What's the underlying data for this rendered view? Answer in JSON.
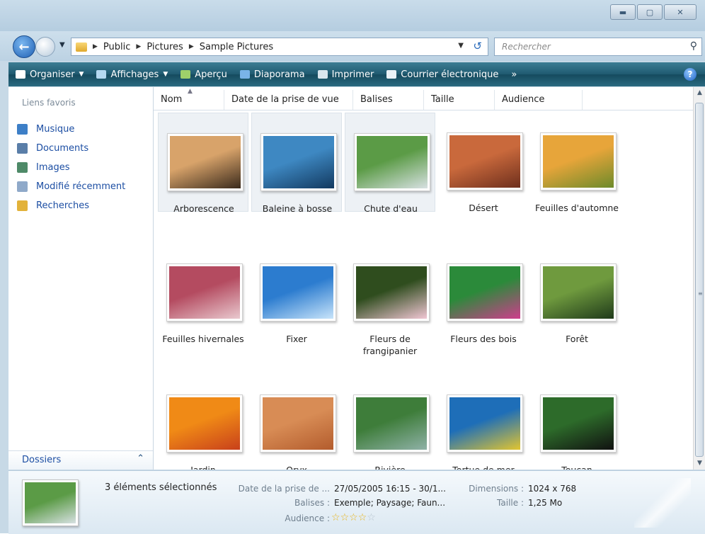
{
  "window": {
    "buttons": {
      "minimize": "▬",
      "maximize": "▢",
      "close": "✕"
    }
  },
  "address": {
    "crumbs": [
      "Public",
      "Pictures",
      "Sample Pictures"
    ],
    "search_placeholder": "Rechercher"
  },
  "toolbar": {
    "items": [
      {
        "label": "Organiser",
        "icon": "organize-icon",
        "dropdown": true,
        "color": "#ffffff"
      },
      {
        "label": "Affichages",
        "icon": "views-icon",
        "dropdown": true,
        "color": "#b4d8f0"
      },
      {
        "label": "Aperçu",
        "icon": "preview-icon",
        "dropdown": false,
        "color": "#9fd06a"
      },
      {
        "label": "Diaporama",
        "icon": "slideshow-icon",
        "dropdown": false,
        "color": "#7ab4e8"
      },
      {
        "label": "Imprimer",
        "icon": "print-icon",
        "dropdown": false,
        "color": "#d9e6ee"
      },
      {
        "label": "Courrier électronique",
        "icon": "email-icon",
        "dropdown": false,
        "color": "#e9f1f6"
      }
    ],
    "more": "»"
  },
  "sidebar": {
    "title": "Liens favoris",
    "items": [
      {
        "label": "Musique",
        "icon": "music-icon",
        "color": "#3d7fc7"
      },
      {
        "label": "Documents",
        "icon": "documents-icon",
        "color": "#5a7ea8"
      },
      {
        "label": "Images",
        "icon": "images-icon",
        "color": "#4e8a68"
      },
      {
        "label": "Modifié récemment",
        "icon": "recent-icon",
        "color": "#8fa9c9"
      },
      {
        "label": "Recherches",
        "icon": "searches-icon",
        "color": "#e2b23a"
      }
    ],
    "folders_label": "Dossiers"
  },
  "columns": [
    "Nom",
    "Date de la prise de vue",
    "Balises",
    "Taille",
    "Audience"
  ],
  "files": [
    {
      "name": "Arborescence",
      "selected": true,
      "c1": "#d8a36a",
      "c2": "#3a2a1c"
    },
    {
      "name": "Baleine à bosse",
      "selected": true,
      "c1": "#3e88c2",
      "c2": "#12395f"
    },
    {
      "name": "Chute d'eau",
      "selected": true,
      "c1": "#5b9b46",
      "c2": "#d7e0e2"
    },
    {
      "name": "Désert",
      "selected": false,
      "c1": "#c9693c",
      "c2": "#6e2f1d"
    },
    {
      "name": "Feuilles d'automne",
      "selected": false,
      "c1": "#e7a53a",
      "c2": "#6c8a2a"
    },
    {
      "name": "Feuilles hivernales",
      "selected": false,
      "c1": "#b44b60",
      "c2": "#e9c9cf"
    },
    {
      "name": "Fixer",
      "selected": false,
      "c1": "#2c7ccf",
      "c2": "#c8e4fa"
    },
    {
      "name": "Fleurs de frangipanier",
      "selected": false,
      "c1": "#2f4d1e",
      "c2": "#f1c6d4"
    },
    {
      "name": "Fleurs des bois",
      "selected": false,
      "c1": "#2b8a3a",
      "c2": "#cf3d8d"
    },
    {
      "name": "Forêt",
      "selected": false,
      "c1": "#6f9a3e",
      "c2": "#1f3a1a"
    },
    {
      "name": "Jardin",
      "selected": false,
      "c1": "#f08a16",
      "c2": "#c8401b"
    },
    {
      "name": "Oryx",
      "selected": false,
      "c1": "#d88c55",
      "c2": "#b35c2d"
    },
    {
      "name": "Rivière",
      "selected": false,
      "c1": "#3e7d3a",
      "c2": "#8fb1a7"
    },
    {
      "name": "Tortue de mer",
      "selected": false,
      "c1": "#1e6eb8",
      "c2": "#e2c530"
    },
    {
      "name": "Toucan",
      "selected": false,
      "c1": "#2d6b2a",
      "c2": "#111111"
    }
  ],
  "details": {
    "summary": "3 éléments sélectionnés",
    "date_label": "Date de la prise de ...",
    "date_value": "27/05/2005 16:15 - 30/1...",
    "dimensions_label": "Dimensions :",
    "dimensions_value": "1024 x 768",
    "tags_label": "Balises :",
    "tags_value": "Exemple; Paysage; Faun...",
    "size_label": "Taille :",
    "size_value": "1,25 Mo",
    "audience_label": "Audience :",
    "rating_stars": 4,
    "rating_max": 5
  }
}
